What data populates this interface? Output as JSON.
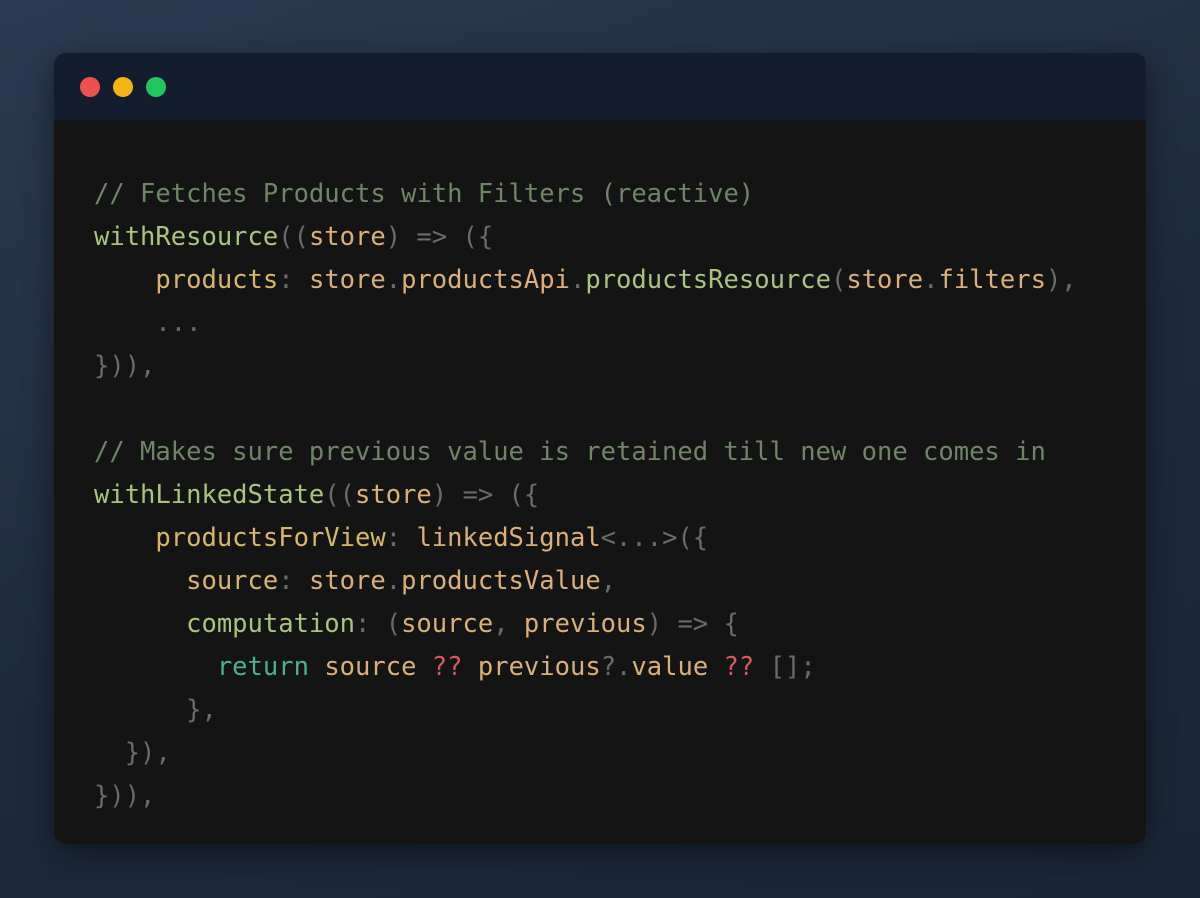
{
  "window": {
    "controls": [
      {
        "name": "close-dot",
        "color": "#ee5050"
      },
      {
        "name": "minimize-dot",
        "color": "#f2b515"
      },
      {
        "name": "zoom-dot",
        "color": "#22c55e"
      }
    ]
  },
  "code_lines": [
    [
      {
        "t": "// Fetches Products with Filters (reactive)",
        "c": "comment"
      }
    ],
    [
      {
        "t": "withResource",
        "c": "func"
      },
      {
        "t": "((",
        "c": "punc"
      },
      {
        "t": "store",
        "c": "param"
      },
      {
        "t": ") => ({",
        "c": "punc"
      }
    ],
    [
      {
        "t": "    ",
        "c": "punc"
      },
      {
        "t": "products",
        "c": "prop"
      },
      {
        "t": ": ",
        "c": "punc"
      },
      {
        "t": "store",
        "c": "ident"
      },
      {
        "t": ".",
        "c": "punc"
      },
      {
        "t": "productsApi",
        "c": "ident"
      },
      {
        "t": ".",
        "c": "punc"
      },
      {
        "t": "productsResource",
        "c": "func"
      },
      {
        "t": "(",
        "c": "punc"
      },
      {
        "t": "store",
        "c": "ident"
      },
      {
        "t": ".",
        "c": "punc"
      },
      {
        "t": "filters",
        "c": "ident"
      },
      {
        "t": "),",
        "c": "punc"
      }
    ],
    [
      {
        "t": "    ...",
        "c": "punc"
      }
    ],
    [
      {
        "t": "})),",
        "c": "punc"
      }
    ],
    [
      {
        "t": "",
        "c": "punc"
      }
    ],
    [
      {
        "t": "// Makes sure previous value is retained till new one comes in",
        "c": "comment"
      }
    ],
    [
      {
        "t": "withLinkedState",
        "c": "func"
      },
      {
        "t": "((",
        "c": "punc"
      },
      {
        "t": "store",
        "c": "param"
      },
      {
        "t": ") => ({",
        "c": "punc"
      }
    ],
    [
      {
        "t": "    ",
        "c": "punc"
      },
      {
        "t": "productsForView",
        "c": "prop"
      },
      {
        "t": ": ",
        "c": "punc"
      },
      {
        "t": "linkedSignal",
        "c": "ident"
      },
      {
        "t": "<...>({",
        "c": "punc"
      }
    ],
    [
      {
        "t": "      ",
        "c": "punc"
      },
      {
        "t": "source",
        "c": "prop"
      },
      {
        "t": ": ",
        "c": "punc"
      },
      {
        "t": "store",
        "c": "ident"
      },
      {
        "t": ".",
        "c": "punc"
      },
      {
        "t": "productsValue",
        "c": "ident"
      },
      {
        "t": ",",
        "c": "punc"
      }
    ],
    [
      {
        "t": "      ",
        "c": "punc"
      },
      {
        "t": "computation",
        "c": "func"
      },
      {
        "t": ": (",
        "c": "punc"
      },
      {
        "t": "source",
        "c": "param"
      },
      {
        "t": ", ",
        "c": "punc"
      },
      {
        "t": "previous",
        "c": "param"
      },
      {
        "t": ") => {",
        "c": "punc"
      }
    ],
    [
      {
        "t": "        ",
        "c": "punc"
      },
      {
        "t": "return",
        "c": "kw"
      },
      {
        "t": " ",
        "c": "punc"
      },
      {
        "t": "source",
        "c": "ident"
      },
      {
        "t": " ",
        "c": "punc"
      },
      {
        "t": "??",
        "c": "op"
      },
      {
        "t": " ",
        "c": "punc"
      },
      {
        "t": "previous",
        "c": "ident"
      },
      {
        "t": "?.",
        "c": "punc"
      },
      {
        "t": "value",
        "c": "ident"
      },
      {
        "t": " ",
        "c": "punc"
      },
      {
        "t": "??",
        "c": "op"
      },
      {
        "t": " [];",
        "c": "punc"
      }
    ],
    [
      {
        "t": "      },",
        "c": "punc"
      }
    ],
    [
      {
        "t": "  }),",
        "c": "punc"
      }
    ],
    [
      {
        "t": "})),",
        "c": "punc"
      }
    ]
  ]
}
